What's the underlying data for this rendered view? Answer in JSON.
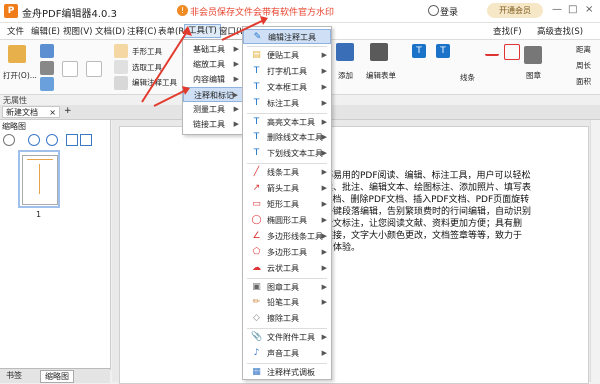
{
  "titlebar": {
    "app_title": "金舟PDF编辑器4.0.3",
    "warning": "非会员保存文件会带有软件官方水印",
    "login": "登录",
    "vip": "开通会员",
    "minimize": "—",
    "maximize": "□",
    "close": "×"
  },
  "menubar": {
    "items": [
      "文件",
      "编辑(E)",
      "视图(V)",
      "文档(D)",
      "注释(C)",
      "表单(R)",
      "工具(T)",
      "窗口(W)"
    ],
    "active_index": 6,
    "right_find": "查找(F)",
    "right_adv": "高级查找(S)"
  },
  "ribbon": {
    "open": "打开(O)...",
    "hand": "手形工具",
    "select": "选取工具",
    "edit_annot": "编辑注释工具",
    "add": "添加",
    "edit_form": "编辑表单",
    "line": "线条",
    "stamp": "图章",
    "dist": "距离",
    "perimeter": "周长",
    "area": "面积"
  },
  "attributes": "无属性",
  "tabs": {
    "doc": "新建文档",
    "close": "×",
    "add": "+"
  },
  "thumbnails": {
    "title": "缩略图",
    "page_number": "1"
  },
  "bottom_tabs": [
    "书签",
    "缩略图"
  ],
  "document": {
    "lines": [
      "款轻巧易用的PDF阅读、编辑、标注工具，用户可以轻松",
      "、阅读、批注、编辑文本、绘图标注、添加照片、填写表",
      "PDF文档、删除PDF文档、插入PDF文档、PDF页面旋转",
      "支持一键段落编辑，告别繁琐费时的行间编辑，自动识别",
      "进行全文标注，让您阅读文献、资料更加方便；具有删",
      "片、链接，文字大小颜色更改，文档签章等等，致力于",
      "的使用体验。"
    ]
  },
  "tools_menu": {
    "items": [
      "基础工具",
      "缩放工具",
      "内容编辑",
      "注释和标记",
      "测量工具",
      "链接工具"
    ],
    "highlighted_index": 3
  },
  "annot_menu": {
    "items": [
      "编辑注释工具",
      "便贴工具",
      "打字机工具",
      "文本框工具",
      "标注工具",
      "高亮文本工具",
      "删除线文本工具",
      "下划线文本工具",
      "线条工具",
      "箭头工具",
      "矩形工具",
      "椭圆形工具",
      "多边形线条工具",
      "多边形工具",
      "云状工具",
      "图章工具",
      "铅笔工具",
      "擦除工具",
      "文件附件工具",
      "声音工具",
      "注释样式调板"
    ],
    "has_submenu": [
      false,
      true,
      true,
      true,
      true,
      true,
      true,
      true,
      true,
      true,
      true,
      true,
      true,
      true,
      true,
      true,
      true,
      false,
      true,
      true,
      false
    ],
    "highlighted_index": 0
  },
  "colors": {
    "accent": "#f07d1a",
    "warning": "#e8432e",
    "highlight": "#cfe0f6",
    "arrow": "#e23b2e"
  }
}
